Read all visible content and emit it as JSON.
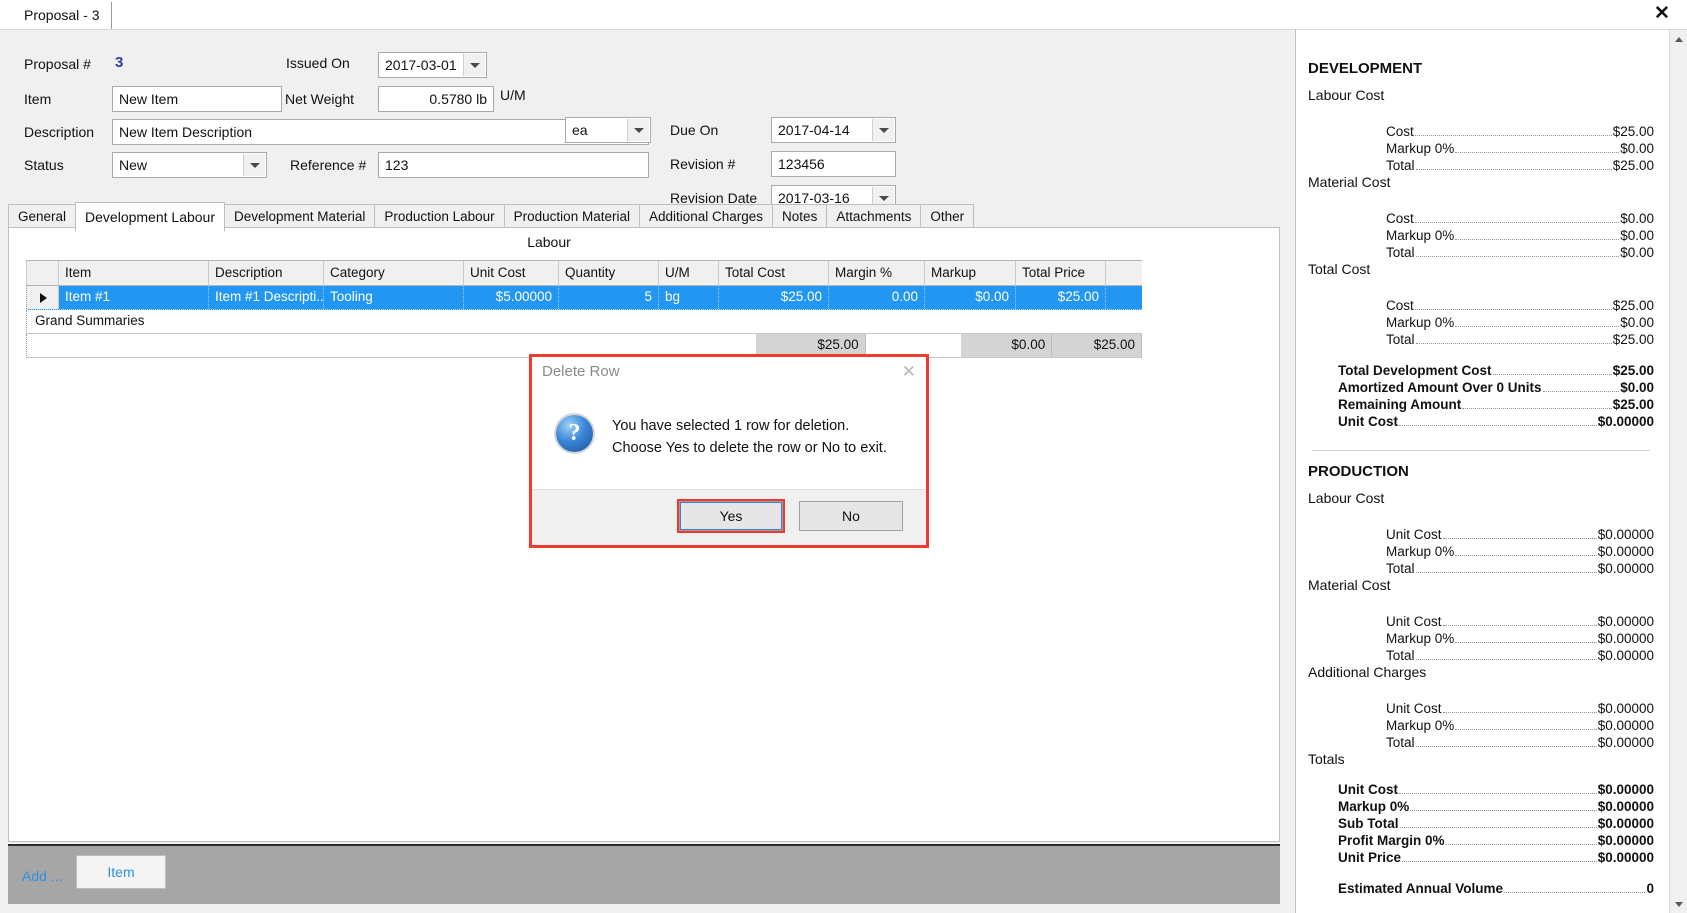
{
  "window": {
    "tab_title": "Proposal - 3",
    "close_label": "✕"
  },
  "form": {
    "proposal_no_label": "Proposal #",
    "proposal_no_value": "3",
    "item_label": "Item",
    "item_value": "New Item",
    "description_label": "Description",
    "description_value": "New Item Description",
    "status_label": "Status",
    "status_value": "New",
    "net_weight_label": "Net Weight",
    "net_weight_value": "0.5780 lb",
    "uom_label": "U/M",
    "uom_value": "ea",
    "reference_label": "Reference #",
    "reference_value": "123",
    "issued_on_label": "Issued On",
    "issued_on_value": "2017-03-01",
    "due_on_label": "Due On",
    "due_on_value": "2017-04-14",
    "revision_no_label": "Revision #",
    "revision_no_value": "123456",
    "revision_date_label": "Revision Date",
    "revision_date_value": "2017-03-16"
  },
  "tabs": [
    {
      "label": "General",
      "active": false
    },
    {
      "label": "Development Labour",
      "active": true
    },
    {
      "label": "Development Material",
      "active": false
    },
    {
      "label": "Production Labour",
      "active": false
    },
    {
      "label": "Production Material",
      "active": false
    },
    {
      "label": "Additional Charges",
      "active": false
    },
    {
      "label": "Notes",
      "active": false
    },
    {
      "label": "Attachments",
      "active": false
    },
    {
      "label": "Other",
      "active": false
    }
  ],
  "grid": {
    "caption": "Labour",
    "columns": [
      "Item",
      "Description",
      "Category",
      "Unit Cost",
      "Quantity",
      "U/M",
      "Total Cost",
      "Margin %",
      "Markup",
      "Total Price"
    ],
    "rows": [
      {
        "item": "Item #1",
        "description": "Item #1 Descripti...",
        "category": "Tooling",
        "unit_cost": "$5.00000",
        "quantity": "5",
        "uom": "bg",
        "total_cost": "$25.00",
        "margin_pct": "0.00",
        "markup": "$0.00",
        "total_price": "$25.00"
      }
    ],
    "grand_summaries_label": "Grand Summaries",
    "summary": {
      "total_cost": "$25.00",
      "markup": "$0.00",
      "total_price": "$25.00"
    }
  },
  "addbar": {
    "add_label": "Add ...",
    "item_button": "Item"
  },
  "dialog": {
    "title": "Delete Row",
    "close_label": "✕",
    "message_line1": "You have selected 1 row for deletion.",
    "message_line2": "Choose Yes to delete the row or No to exit.",
    "yes_label": "Yes",
    "no_label": "No",
    "highlight_color": "#f03a2e"
  },
  "summary_panel": {
    "development": {
      "title": "DEVELOPMENT",
      "groups": [
        {
          "label": "Labour Cost",
          "lines": [
            {
              "label": "Cost",
              "value": "$25.00"
            },
            {
              "label": "Markup 0%",
              "value": "$0.00"
            },
            {
              "label": "Total",
              "value": "$25.00"
            }
          ]
        },
        {
          "label": "Material Cost",
          "lines": [
            {
              "label": "Cost",
              "value": "$0.00"
            },
            {
              "label": "Markup 0%",
              "value": "$0.00"
            },
            {
              "label": "Total",
              "value": "$0.00"
            }
          ]
        },
        {
          "label": "Total Cost",
          "lines": [
            {
              "label": "Cost",
              "value": "$25.00"
            },
            {
              "label": "Markup 0%",
              "value": "$0.00"
            },
            {
              "label": "Total",
              "value": "$25.00"
            }
          ]
        }
      ],
      "totals": [
        {
          "label": "Total Development Cost",
          "value": "$25.00"
        },
        {
          "label": "Amortized Amount Over 0 Units",
          "value": "$0.00"
        },
        {
          "label": "Remaining Amount",
          "value": "$25.00"
        },
        {
          "label": "Unit Cost",
          "value": "$0.00000"
        }
      ]
    },
    "production": {
      "title": "PRODUCTION",
      "groups": [
        {
          "label": "Labour Cost",
          "lines": [
            {
              "label": "Unit Cost",
              "value": "$0.00000"
            },
            {
              "label": "Markup 0%",
              "value": "$0.00000"
            },
            {
              "label": "Total",
              "value": "$0.00000"
            }
          ]
        },
        {
          "label": "Material Cost",
          "lines": [
            {
              "label": "Unit Cost",
              "value": "$0.00000"
            },
            {
              "label": "Markup 0%",
              "value": "$0.00000"
            },
            {
              "label": "Total",
              "value": "$0.00000"
            }
          ]
        },
        {
          "label": "Additional Charges",
          "lines": [
            {
              "label": "Unit Cost",
              "value": "$0.00000"
            },
            {
              "label": "Markup 0%",
              "value": "$0.00000"
            },
            {
              "label": "Total",
              "value": "$0.00000"
            }
          ]
        },
        {
          "label": "Totals",
          "lines": []
        }
      ],
      "totals": [
        {
          "label": "Unit Cost",
          "value": "$0.00000"
        },
        {
          "label": "Markup 0%",
          "value": "$0.00000"
        },
        {
          "label": "Sub Total",
          "value": "$0.00000"
        },
        {
          "label": "Profit Margin 0%",
          "value": "$0.00000"
        },
        {
          "label": "Unit Price",
          "value": "$0.00000"
        }
      ],
      "footer": [
        {
          "label": "Estimated Annual Volume",
          "value": "0"
        }
      ]
    }
  }
}
